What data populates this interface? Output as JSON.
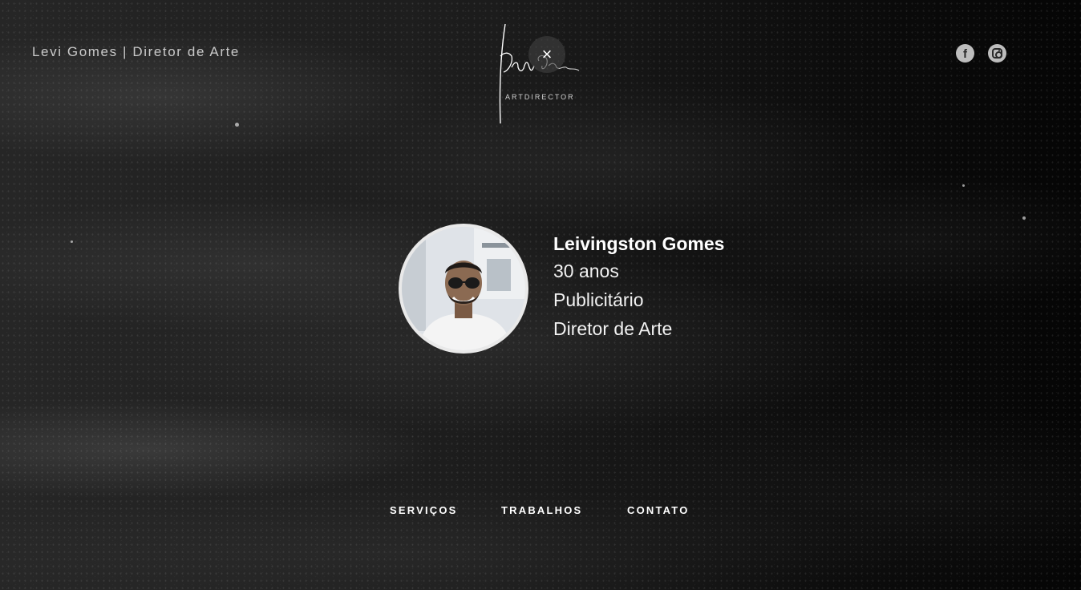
{
  "header": {
    "site_title": "Levi Gomes | Diretor de Arte",
    "logo_signature": "Levi Gomes",
    "logo_subtitle": "ARTDIRECTOR",
    "close_symbol": "×"
  },
  "social": [
    {
      "name": "facebook",
      "icon": "facebook-icon",
      "glyph": "f"
    },
    {
      "name": "instagram",
      "icon": "instagram-icon"
    }
  ],
  "profile": {
    "name": "Leivingston Gomes",
    "age": "30 anos",
    "role1": "Publicitário",
    "role2": "Diretor de Arte"
  },
  "nav": {
    "items": [
      {
        "label": "SERVIÇOS"
      },
      {
        "label": "TRABALHOS"
      },
      {
        "label": "CONTATO"
      }
    ]
  },
  "colors": {
    "background": "#0b0b0b",
    "text": "#ffffff",
    "muted_text": "#c9c9c9",
    "social_icon_bg": "#bdbdbd"
  }
}
